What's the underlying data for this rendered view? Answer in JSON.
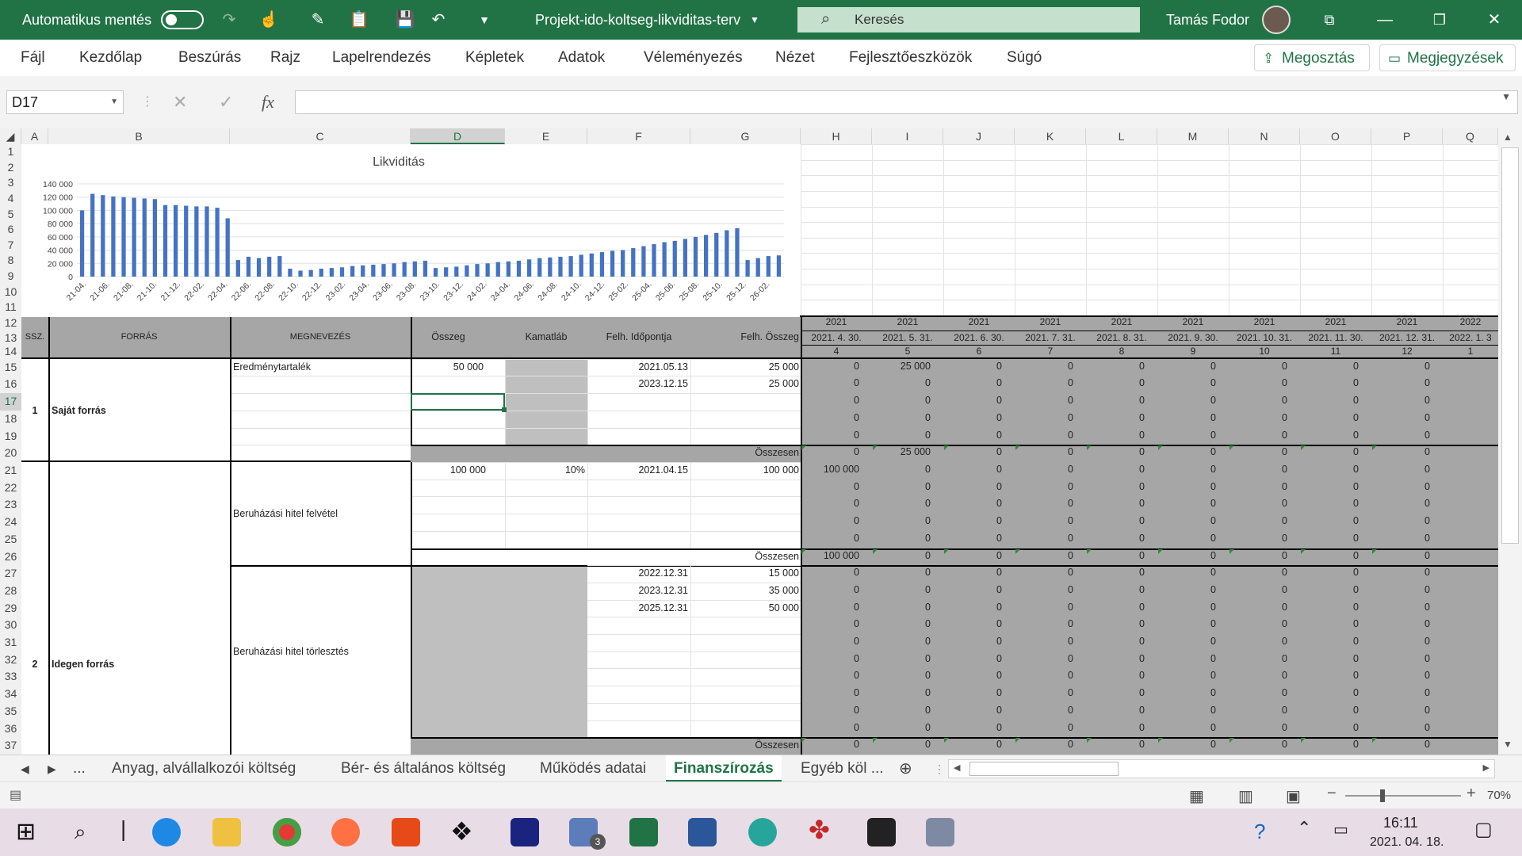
{
  "titlebar": {
    "autosave_label": "Automatikus mentés",
    "file_name": "Projekt-ido-koltseg-likviditas-terv",
    "search_placeholder": "Keresés",
    "user_name": "Tamás Fodor"
  },
  "ribbon": {
    "tabs": [
      "Fájl",
      "Kezdőlap",
      "Beszúrás",
      "Rajz",
      "Lapelrendezés",
      "Képletek",
      "Adatok",
      "Véleményezés",
      "Nézet",
      "Fejlesztőeszközök",
      "Súgó"
    ],
    "share_label": "Megosztás",
    "comments_label": "Megjegyzések"
  },
  "formula_bar": {
    "name_box": "D17",
    "fx": "fx",
    "value": ""
  },
  "columns": [
    "A",
    "B",
    "C",
    "D",
    "E",
    "F",
    "G",
    "H",
    "I",
    "J",
    "K",
    "L",
    "M",
    "N",
    "O",
    "P",
    "Q"
  ],
  "rows": [
    "1",
    "2",
    "3",
    "4",
    "5",
    "6",
    "7",
    "8",
    "9",
    "10",
    "11",
    "12",
    "13",
    "14",
    "15",
    "16",
    "17",
    "18",
    "19",
    "20",
    "21",
    "22",
    "23",
    "24",
    "25",
    "26",
    "27",
    "28",
    "29",
    "30",
    "31",
    "32",
    "33",
    "34",
    "35",
    "36",
    "37"
  ],
  "chart_data": {
    "type": "bar",
    "title": "Likviditás",
    "ylim": [
      0,
      140000
    ],
    "yticks": [
      "140 000",
      "120 000",
      "100 000",
      "80 000",
      "60 000",
      "40 000",
      "20 000",
      "0"
    ],
    "xticks": [
      "21-04.",
      "21-06.",
      "21-08.",
      "21-10.",
      "21-12.",
      "22-02.",
      "22-04.",
      "22-06.",
      "22-08.",
      "22-10.",
      "22-12.",
      "23-02.",
      "23-04.",
      "23-06.",
      "23-08.",
      "23-10.",
      "23-12.",
      "24-02.",
      "24-04.",
      "24-06.",
      "24-08.",
      "24-10.",
      "24-12.",
      "25-02.",
      "25-04.",
      "25-06.",
      "25-08.",
      "25-10.",
      "25-12.",
      "26-02."
    ],
    "values": [
      100000,
      125000,
      123000,
      121000,
      120000,
      119000,
      118000,
      117000,
      108000,
      108000,
      107000,
      106000,
      106000,
      104000,
      88000,
      25000,
      30000,
      28000,
      30000,
      31000,
      12000,
      9000,
      10000,
      12000,
      13000,
      14000,
      16000,
      17000,
      18000,
      19000,
      20000,
      22000,
      23000,
      24000,
      13000,
      14000,
      15000,
      17000,
      19000,
      20000,
      22000,
      23000,
      24000,
      26000,
      28000,
      29000,
      30000,
      31000,
      33000,
      35000,
      37000,
      39000,
      40000,
      43000,
      46000,
      49000,
      52000,
      54000,
      57000,
      60000,
      63000,
      66000,
      70000,
      73000,
      25000,
      28000,
      31000,
      32000
    ],
    "bar_color": "#4472c4"
  },
  "headers": {
    "row12": [
      "2021",
      "2021",
      "2021",
      "2021",
      "2021",
      "2021",
      "2021",
      "2021",
      "2021",
      "2022"
    ],
    "row13": [
      "2021. 4. 30.",
      "2021. 5. 31.",
      "2021. 6. 30.",
      "2021. 7. 31.",
      "2021. 8. 31.",
      "2021. 9. 30.",
      "2021. 10. 31.",
      "2021. 11. 30.",
      "2021. 12. 31.",
      "2022. 1. 3"
    ],
    "row14": [
      "4",
      "5",
      "6",
      "7",
      "8",
      "9",
      "10",
      "11",
      "12",
      "1"
    ],
    "ssz": "SSZ.",
    "forras": "FORRÁS",
    "megnevezes": "MEGNEVEZÉS",
    "osszeg": "Összeg",
    "kamatlab": "Kamatláb",
    "felh_idopontja": "Felh. Időpontja",
    "felh_osszeg": "Felh. Összeg"
  },
  "block1": {
    "num": "1",
    "forras": "Saját forrás",
    "megnevezes": "Eredménytartalék",
    "osszeg": "50 000",
    "dates": [
      "2021.05.13",
      "2023.12.15"
    ],
    "amounts": [
      "25 000",
      "25 000"
    ],
    "row15": [
      "0",
      "25 000",
      "0",
      "0",
      "0",
      "0",
      "0",
      "0",
      "0"
    ],
    "zero": "0",
    "total_label": "Összesen",
    "total_row": [
      "0",
      "25 000",
      "0",
      "0",
      "0",
      "0",
      "0",
      "0",
      "0"
    ]
  },
  "block2": {
    "num": "2",
    "forras": "Idegen forrás",
    "loan_label": "Beruházási hitel felvétel",
    "loan_osszeg": "100 000",
    "loan_kamat": "10%",
    "loan_date": "2021.04.15",
    "loan_amount": "100 000",
    "loan_row21": [
      "100 000",
      "0",
      "0",
      "0",
      "0",
      "0",
      "0",
      "0",
      "0"
    ],
    "loan_total": [
      "100 000",
      "0",
      "0",
      "0",
      "0",
      "0",
      "0",
      "0",
      "0"
    ],
    "repay_label": "Beruházási hitel törlesztés",
    "repay_dates": [
      "2022.12.31",
      "2023.12.31",
      "2025.12.31"
    ],
    "repay_amounts": [
      "15 000",
      "35 000",
      "50 000"
    ],
    "total_label": "Összesen"
  },
  "sheet_tabs": [
    "...",
    "Anyag, alvállalkozói költség",
    "Bér- és általános költség",
    "Működés adatai",
    "Finanszírozás",
    "Egyéb köl ..."
  ],
  "active_tab": "Finanszírozás",
  "status": {
    "zoom": "70%"
  },
  "taskbar": {
    "time": "16:11",
    "date": "2021. 04. 18.",
    "mail_badge": "3"
  }
}
